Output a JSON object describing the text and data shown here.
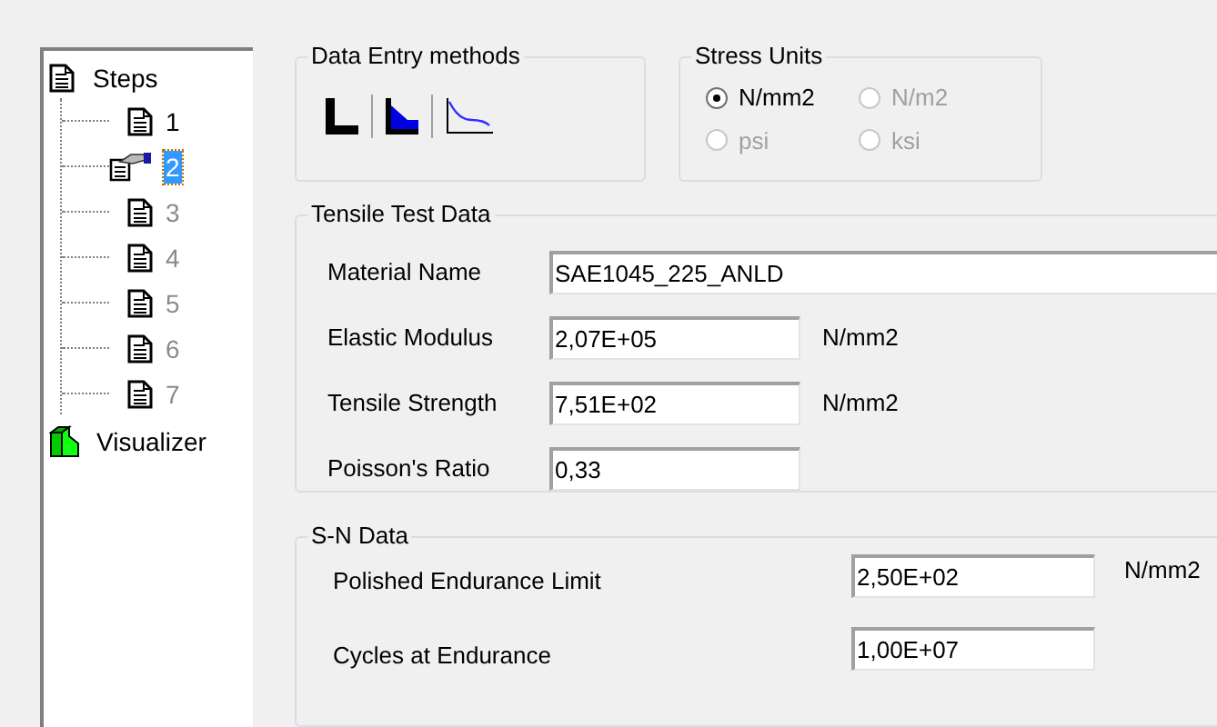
{
  "tree": {
    "label": "Steps",
    "children": [
      {
        "label": "1",
        "selected": false,
        "disabled": false
      },
      {
        "label": "2",
        "selected": true,
        "disabled": false
      },
      {
        "label": "3",
        "selected": false,
        "disabled": true
      },
      {
        "label": "4",
        "selected": false,
        "disabled": true
      },
      {
        "label": "5",
        "selected": false,
        "disabled": true
      },
      {
        "label": "6",
        "selected": false,
        "disabled": true
      },
      {
        "label": "7",
        "selected": false,
        "disabled": true
      }
    ]
  },
  "visualizer": {
    "label": "Visualizer"
  },
  "data_entry": {
    "title": "Data Entry methods"
  },
  "stress_units": {
    "title": "Stress Units",
    "options": [
      {
        "label": "N/mm2",
        "selected": true,
        "disabled": false
      },
      {
        "label": "N/m2",
        "selected": false,
        "disabled": true
      },
      {
        "label": "psi",
        "selected": false,
        "disabled": true
      },
      {
        "label": "ksi",
        "selected": false,
        "disabled": true
      }
    ]
  },
  "tensile": {
    "title": "Tensile Test Data",
    "fields": [
      {
        "kind": "wide",
        "label": "Material Name",
        "value": "SAE1045_225_ANLD"
      },
      {
        "kind": "short",
        "label": "Elastic Modulus",
        "value": "2,07E+05",
        "unit": "N/mm2"
      },
      {
        "kind": "short",
        "label": "Tensile Strength",
        "value": "7,51E+02",
        "unit": "N/mm2"
      },
      {
        "kind": "short",
        "label": "Poisson's Ratio",
        "value": "0,33"
      }
    ]
  },
  "sn": {
    "title": "S-N  Data",
    "fields": [
      {
        "label": "Polished Endurance Limit",
        "value": "2,50E+02",
        "unit": "N/mm2"
      },
      {
        "label": "Cycles at Endurance",
        "value": "1,00E+07"
      }
    ]
  }
}
